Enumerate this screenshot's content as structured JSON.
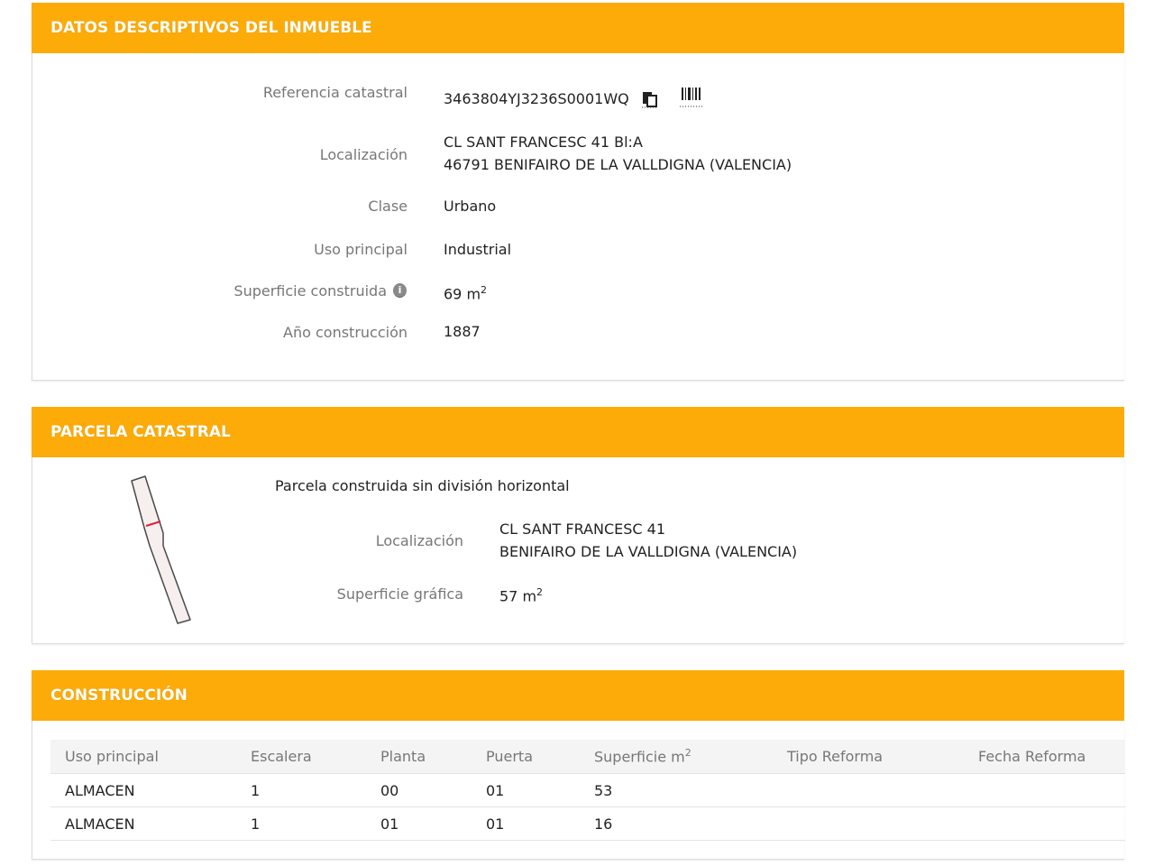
{
  "datos": {
    "header": "DATOS DESCRIPTIVOS DEL INMUEBLE",
    "ref_label": "Referencia catastral",
    "ref_value": "3463804YJ3236S0001WQ",
    "loc_label": "Localización",
    "loc_line1": "CL SANT FRANCESC 41 Bl:A",
    "loc_line2": "46791 BENIFAIRO DE LA VALLDIGNA (VALENCIA)",
    "clase_label": "Clase",
    "clase_value": "Urbano",
    "uso_label": "Uso principal",
    "uso_value": "Industrial",
    "sup_label": "Superficie construida",
    "sup_value": "69 m",
    "sup_exp": "2",
    "anio_label": "Año construcción",
    "anio_value": "1887"
  },
  "parcela": {
    "header": "PARCELA CATASTRAL",
    "subtitle": "Parcela construida sin división horizontal",
    "loc_label": "Localización",
    "loc_line1": "CL SANT FRANCESC 41",
    "loc_line2": "BENIFAIRO DE LA VALLDIGNA (VALENCIA)",
    "sup_label": "Superficie gráfica",
    "sup_value": "57 m",
    "sup_exp": "2"
  },
  "construccion": {
    "header": "CONSTRUCCIÓN",
    "columns": [
      "Uso principal",
      "Escalera",
      "Planta",
      "Puerta",
      "Superficie m",
      "Tipo Reforma",
      "Fecha Reforma"
    ],
    "sup_col_exp": "2",
    "rows": [
      [
        "ALMACEN",
        "1",
        "00",
        "01",
        "53",
        "",
        ""
      ],
      [
        "ALMACEN",
        "1",
        "01",
        "01",
        "16",
        "",
        ""
      ]
    ]
  },
  "icons": {
    "copy": "copy-icon",
    "barcode": "barcode-icon",
    "info": "info-icon"
  },
  "colors": {
    "header_bg": "#fcab08",
    "label": "#777777",
    "value": "#222222"
  }
}
